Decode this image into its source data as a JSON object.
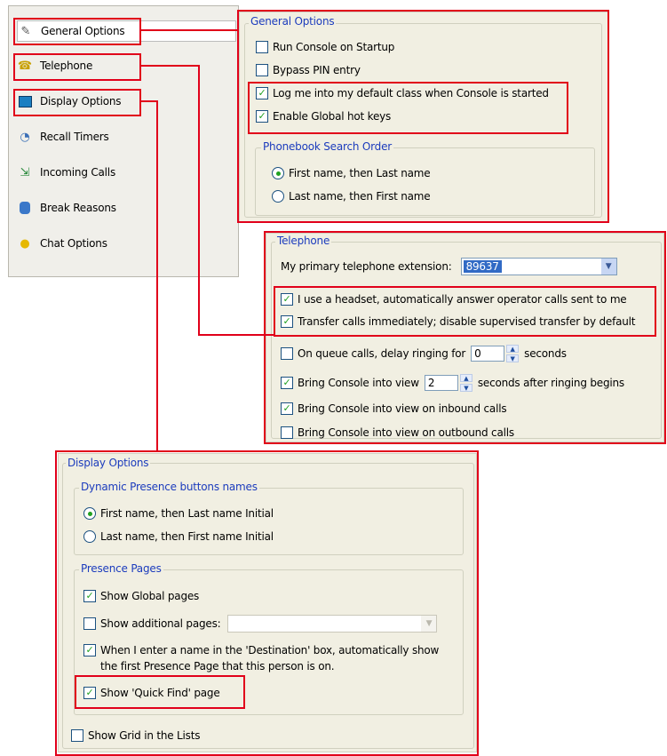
{
  "nav": {
    "items": [
      {
        "label": "General Options",
        "icon": "wand-icon"
      },
      {
        "label": "Telephone",
        "icon": "phone-icon"
      },
      {
        "label": "Display Options",
        "icon": "monitor-icon"
      },
      {
        "label": "Recall Timers",
        "icon": "clock-icon"
      },
      {
        "label": "Incoming Calls",
        "icon": "incoming-call-icon"
      },
      {
        "label": "Break Reasons",
        "icon": "break-icon"
      },
      {
        "label": "Chat Options",
        "icon": "chat-bubble-icon"
      }
    ]
  },
  "general": {
    "title": "General Options",
    "run_console": "Run Console on Startup",
    "bypass_pin": "Bypass PIN entry",
    "log_me": "Log me into my default class when Console is started",
    "global_hotkeys": "Enable Global hot keys",
    "phonebook_title": "Phonebook Search Order",
    "first_last": "First name, then Last name",
    "last_first": "Last name, then First name"
  },
  "telephone": {
    "title": "Telephone",
    "extension_label": "My primary telephone extension:",
    "extension_value": "89637",
    "headset": "I use a headset, automatically answer operator calls sent to me",
    "transfer": "Transfer calls immediately; disable supervised transfer by default",
    "queue_delay": "On queue calls, delay ringing for",
    "queue_delay_value": "0",
    "seconds": "seconds",
    "bring_view": "Bring Console into view",
    "bring_view_value": "2",
    "seconds_after": "seconds after ringing begins",
    "bring_inbound": "Bring Console into view on inbound calls",
    "bring_outbound": "Bring Console into view on outbound calls"
  },
  "display": {
    "title": "Display Options",
    "dyn_title": "Dynamic Presence buttons names",
    "first_last_initial": "First name, then Last name Initial",
    "last_first_initial": "Last name, then First name Initial",
    "pages_title": "Presence Pages",
    "show_global": "Show Global pages",
    "show_additional": "Show additional pages:",
    "destination_line1": "When I enter a name in the 'Destination' box, automatically show",
    "destination_line2": "the first Presence Page that this person is on.",
    "quick_find": "Show 'Quick Find' page",
    "show_grid": "Show Grid in the Lists"
  },
  "colors": {
    "highlight": "#e1001a",
    "group_title": "#1c3cbd",
    "check": "#21a121"
  }
}
